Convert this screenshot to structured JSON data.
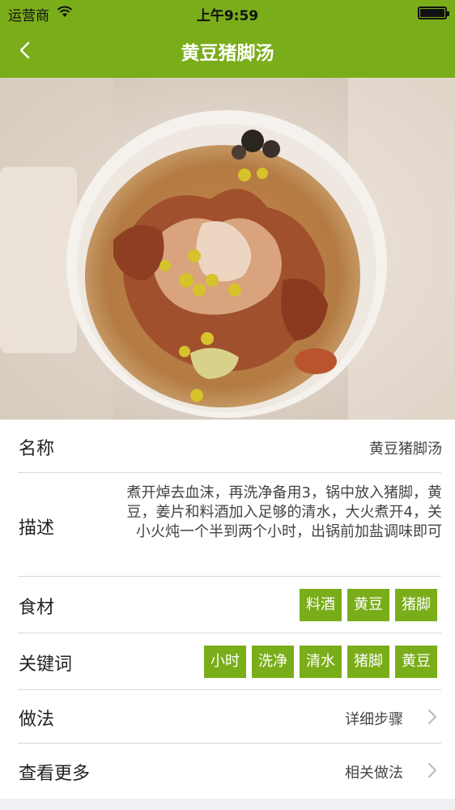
{
  "status_bar": {
    "carrier": "运营商",
    "time": "上午9:59"
  },
  "nav": {
    "title": "黄豆猪脚汤"
  },
  "hero": {
    "image": "soup-bowl-photo"
  },
  "details": {
    "name_label": "名称",
    "name_value": "黄豆猪脚汤",
    "desc_label": "描述",
    "desc_value": "煮开焯去血沫，再洗净备用3，锅中放入猪脚，黄豆，姜片和料酒加入足够的清水，大火煮开4，关小火炖一个半到两个小时，出锅前加盐调味即可",
    "ingredients_label": "食材",
    "ingredients": [
      "料酒",
      "黄豆",
      "猪脚"
    ],
    "keywords_label": "关键词",
    "keywords": [
      "小时",
      "洗净",
      "清水",
      "猪脚",
      "黄豆"
    ],
    "method_label": "做法",
    "method_link": "详细步骤",
    "more_label": "查看更多",
    "more_link": "相关做法"
  },
  "colors": {
    "brand_green": "#7aad1a"
  }
}
